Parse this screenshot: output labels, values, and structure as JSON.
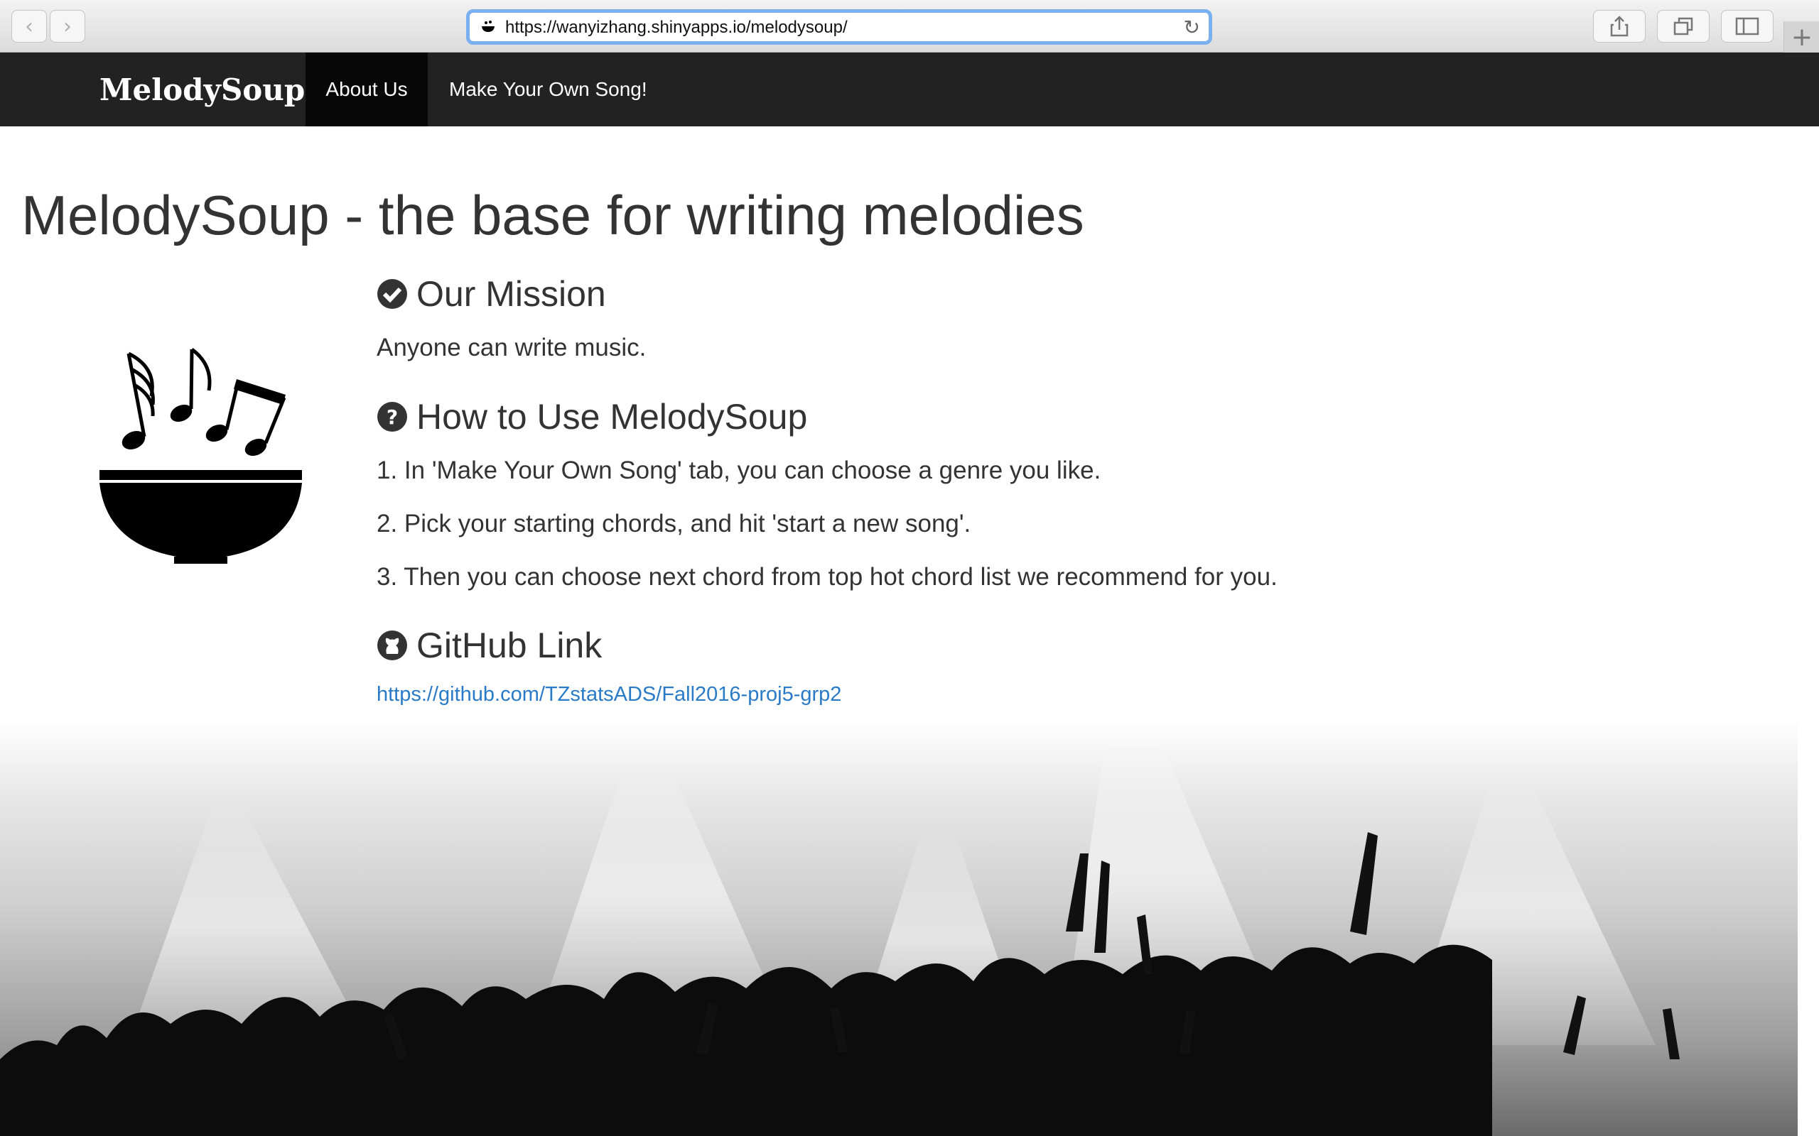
{
  "browser": {
    "url": "https://wanyizhang.shinyapps.io/melodysoup/",
    "back_icon": "chevron-left-icon",
    "forward_icon": "chevron-right-icon",
    "reload_icon": "reload-icon",
    "share_icon": "share-icon",
    "tabs_icon": "tabs-icon",
    "sidebar_icon": "sidebar-icon",
    "new_tab_icon": "plus-icon"
  },
  "navbar": {
    "brand": "MelodySoup",
    "tabs": [
      {
        "label": "About Us",
        "active": true
      },
      {
        "label": "Make Your Own Song!",
        "active": false
      }
    ]
  },
  "main": {
    "title": "MelodySoup - the base for writing melodies",
    "mission": {
      "heading": "Our Mission",
      "icon": "check-circle-icon",
      "text": "Anyone can write music."
    },
    "howto": {
      "heading": "How to Use MelodySoup",
      "icon": "question-circle-icon",
      "steps": [
        "1. In 'Make Your Own Song' tab, you can choose a genre you like.",
        "2. Pick your starting chords, and hit 'start a new song'.",
        "3. Then you can choose next chord from top hot chord list we recommend for you."
      ]
    },
    "github": {
      "heading": "GitHub Link",
      "icon": "github-icon",
      "url": "https://github.com/TZstatsADS/Fall2016-proj5-grp2"
    }
  },
  "colors": {
    "navbar_bg": "#222222",
    "active_tab_bg": "#080808",
    "link": "#2a7bc7",
    "address_focus": "#7ab0f0"
  }
}
